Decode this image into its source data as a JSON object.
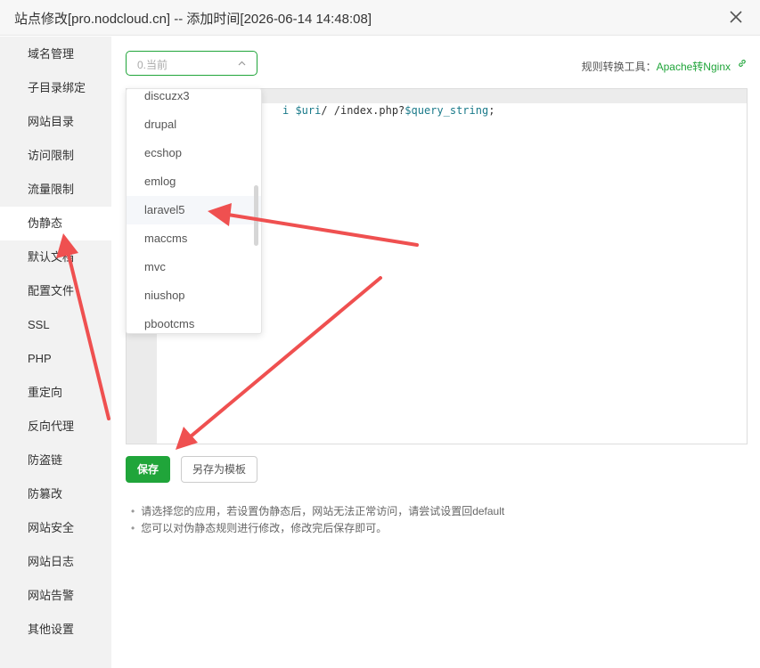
{
  "window": {
    "title": "站点修改[pro.nodcloud.cn] -- 添加时间[2026-06-14 14:48:08]"
  },
  "sidebar": {
    "items": [
      {
        "label": "域名管理"
      },
      {
        "label": "子目录绑定"
      },
      {
        "label": "网站目录"
      },
      {
        "label": "访问限制"
      },
      {
        "label": "流量限制"
      },
      {
        "label": "伪静态"
      },
      {
        "label": "默认文档"
      },
      {
        "label": "配置文件"
      },
      {
        "label": "SSL"
      },
      {
        "label": "PHP"
      },
      {
        "label": "重定向"
      },
      {
        "label": "反向代理"
      },
      {
        "label": "防盗链"
      },
      {
        "label": "防篡改"
      },
      {
        "label": "网站安全"
      },
      {
        "label": "网站日志"
      },
      {
        "label": "网站告警"
      },
      {
        "label": "其他设置"
      }
    ],
    "active": "伪静态"
  },
  "rewrite": {
    "select_value": "0.当前",
    "tool_label": "规则转换工具：",
    "tool_link": "Apache转Nginx",
    "code_prefix": "i ",
    "code_var1": "$uri",
    "code_mid": "/ /index.php?",
    "code_var2": "$query_string",
    "code_end": ";"
  },
  "dropdown": {
    "options": [
      "discuzx3",
      "drupal",
      "ecshop",
      "emlog",
      "laravel5",
      "maccms",
      "mvc",
      "niushop",
      "pbootcms"
    ],
    "hovered": "laravel5"
  },
  "buttons": {
    "save": "保存",
    "save_template": "另存为模板"
  },
  "tips": [
    "请选择您的应用，若设置伪静态后，网站无法正常访问，请尝试设置回default",
    "您可以对伪静态规则进行修改，修改完后保存即可。"
  ],
  "colors": {
    "accent": "#20a53a",
    "annotation": "#ef5050"
  }
}
